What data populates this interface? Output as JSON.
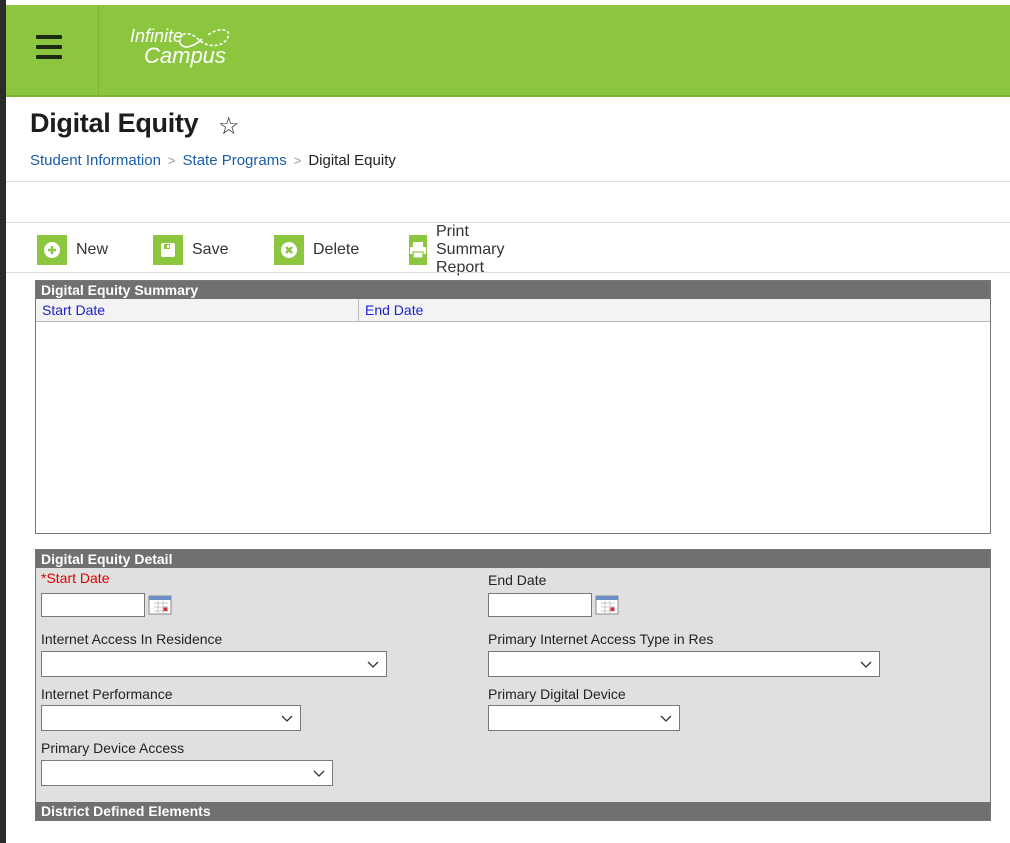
{
  "app": {
    "logo_line1": "Infinite",
    "logo_line2": "Campus"
  },
  "page": {
    "title": "Digital Equity"
  },
  "breadcrumb": {
    "items": [
      "Student Information",
      "State Programs"
    ],
    "current": "Digital Equity",
    "separator": ">"
  },
  "toolbar": {
    "new_label": "New",
    "save_label": "Save",
    "delete_label": "Delete",
    "print_label": "Print Summary Report"
  },
  "summary": {
    "title": "Digital Equity Summary",
    "columns": [
      "Start Date",
      "End Date"
    ],
    "rows": []
  },
  "detail": {
    "title": "Digital Equity Detail",
    "start_date_label": "*Start Date",
    "start_date_value": "",
    "end_date_label": "End Date",
    "end_date_value": "",
    "internet_access_label": "Internet Access In Residence",
    "internet_access_value": "",
    "primary_internet_type_label": "Primary Internet Access Type in Res",
    "primary_internet_type_value": "",
    "internet_performance_label": "Internet Performance",
    "internet_performance_value": "",
    "primary_digital_device_label": "Primary Digital Device",
    "primary_digital_device_value": "",
    "primary_device_access_label": "Primary Device Access",
    "primary_device_access_value": ""
  },
  "district": {
    "title": "District Defined Elements"
  },
  "colors": {
    "brand_green": "#8cc63f",
    "section_header_bg": "#707070",
    "link_blue": "#1a5ea8",
    "required_red": "#e00000"
  },
  "icons": [
    "menu-icon",
    "star-icon",
    "plus-icon",
    "save-icon",
    "delete-icon",
    "print-icon",
    "calendar-icon",
    "chevron-down-icon"
  ]
}
